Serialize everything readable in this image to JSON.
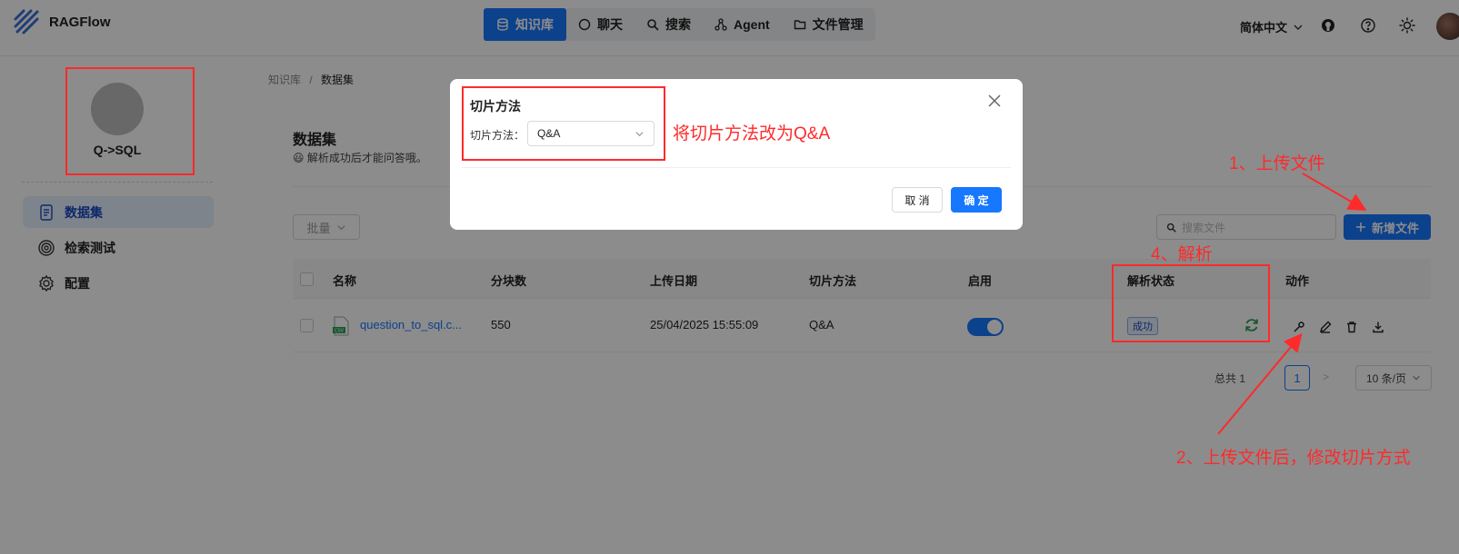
{
  "header": {
    "brand": "RAGFlow",
    "nav": [
      {
        "label": "知识库",
        "icon": "database-icon",
        "active": true
      },
      {
        "label": "聊天",
        "icon": "chat-bubble-icon",
        "active": false
      },
      {
        "label": "搜索",
        "icon": "search-icon",
        "active": false
      },
      {
        "label": "Agent",
        "icon": "agent-graph-icon",
        "active": false
      },
      {
        "label": "文件管理",
        "icon": "folder-icon",
        "active": false
      }
    ],
    "language": "简体中文"
  },
  "sidebar": {
    "kb_name": "Q->SQL",
    "items": [
      {
        "label": "数据集",
        "icon": "document-icon",
        "active": true
      },
      {
        "label": "检索测试",
        "icon": "target-icon",
        "active": false
      },
      {
        "label": "配置",
        "icon": "gear-icon",
        "active": false
      }
    ]
  },
  "main": {
    "breadcrumb": {
      "root": "知识库",
      "sep": "/",
      "current": "数据集"
    },
    "title": "数据集",
    "subtitle": "😃 解析成功后才能问答哦。",
    "bulk_label": "批量",
    "search_placeholder": "搜索文件",
    "add_label": "新增文件",
    "columns": [
      "名称",
      "分块数",
      "上传日期",
      "切片方法",
      "启用",
      "解析状态",
      "动作"
    ],
    "rows": [
      {
        "name": "question_to_sql.c...",
        "chunks": "550",
        "date": "25/04/2025 15:55:09",
        "method": "Q&A",
        "enabled": true,
        "status": "成功"
      }
    ],
    "pagination": {
      "total": "总共 1",
      "page": "1",
      "next": ">",
      "page_size": "10 条/页"
    }
  },
  "dialog": {
    "title": "切片方法",
    "field_label": "切片方法：",
    "field_value": "Q&A",
    "cancel": "取 消",
    "ok": "确 定"
  },
  "annotations": {
    "modal_note": "将切片方法改为Q&A",
    "step1": "1、上传文件",
    "step2": "2、上传文件后，修改切片方式",
    "step4": "4、解析",
    "color": "#ff2a2a"
  },
  "colors": {
    "primary": "#1677ff",
    "overlay": "rgba(0,0,0,0.45)"
  }
}
